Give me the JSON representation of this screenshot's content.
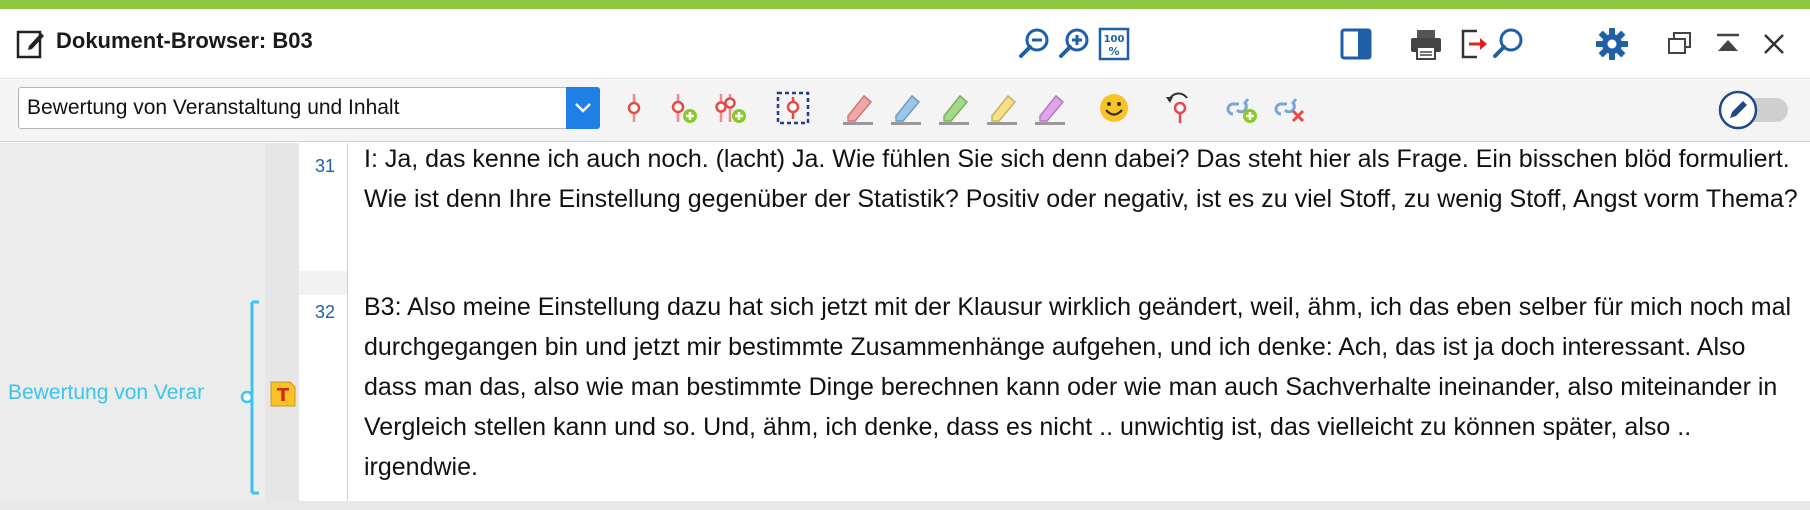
{
  "window": {
    "title": "Dokument-Browser: B03"
  },
  "toolbar": {
    "code_select_value": "Bewertung von Veranstaltung und Inhalt"
  },
  "lines": [
    {
      "number": "31",
      "text": "I: Ja, das kenne ich auch noch. (lacht) Ja. Wie fühlen Sie sich denn dabei? Das steht hier als Frage. Ein bisschen blöd formuliert. Wie ist denn Ihre Einstellung gegenüber der Statistik? Positiv oder negativ, ist es zu viel Stoff, zu wenig Stoff, Angst vorm Thema?"
    },
    {
      "number": "32",
      "text": "B3: Also meine Einstellung dazu hat sich jetzt mit der Klausur wirklich geändert, weil, ähm, ich das eben selber für mich noch mal durchgegangen bin und jetzt mir bestimmte Zusammenhänge aufgehen, und ich denke: Ach, das ist ja doch interessant. Also dass man das, also wie man bestimmte Dinge berechnen kann oder wie man auch Sachverhalte ineinander, also miteinander in Vergleich stellen kann und so. Und, ähm, ich denke, dass es nicht .. unwichtig ist, das vielleicht zu können später, also .. irgendwie."
    }
  ],
  "coding_stripe": {
    "code_label": "Bewertung von Veranstaltung und Inhalt",
    "color": "#3cc3ee"
  },
  "colors": {
    "accent_bar": "#8dc63f",
    "select_button": "#1f7fe6",
    "icon_blue": "#1e5fa8",
    "line_number": "#1f5fa8"
  }
}
